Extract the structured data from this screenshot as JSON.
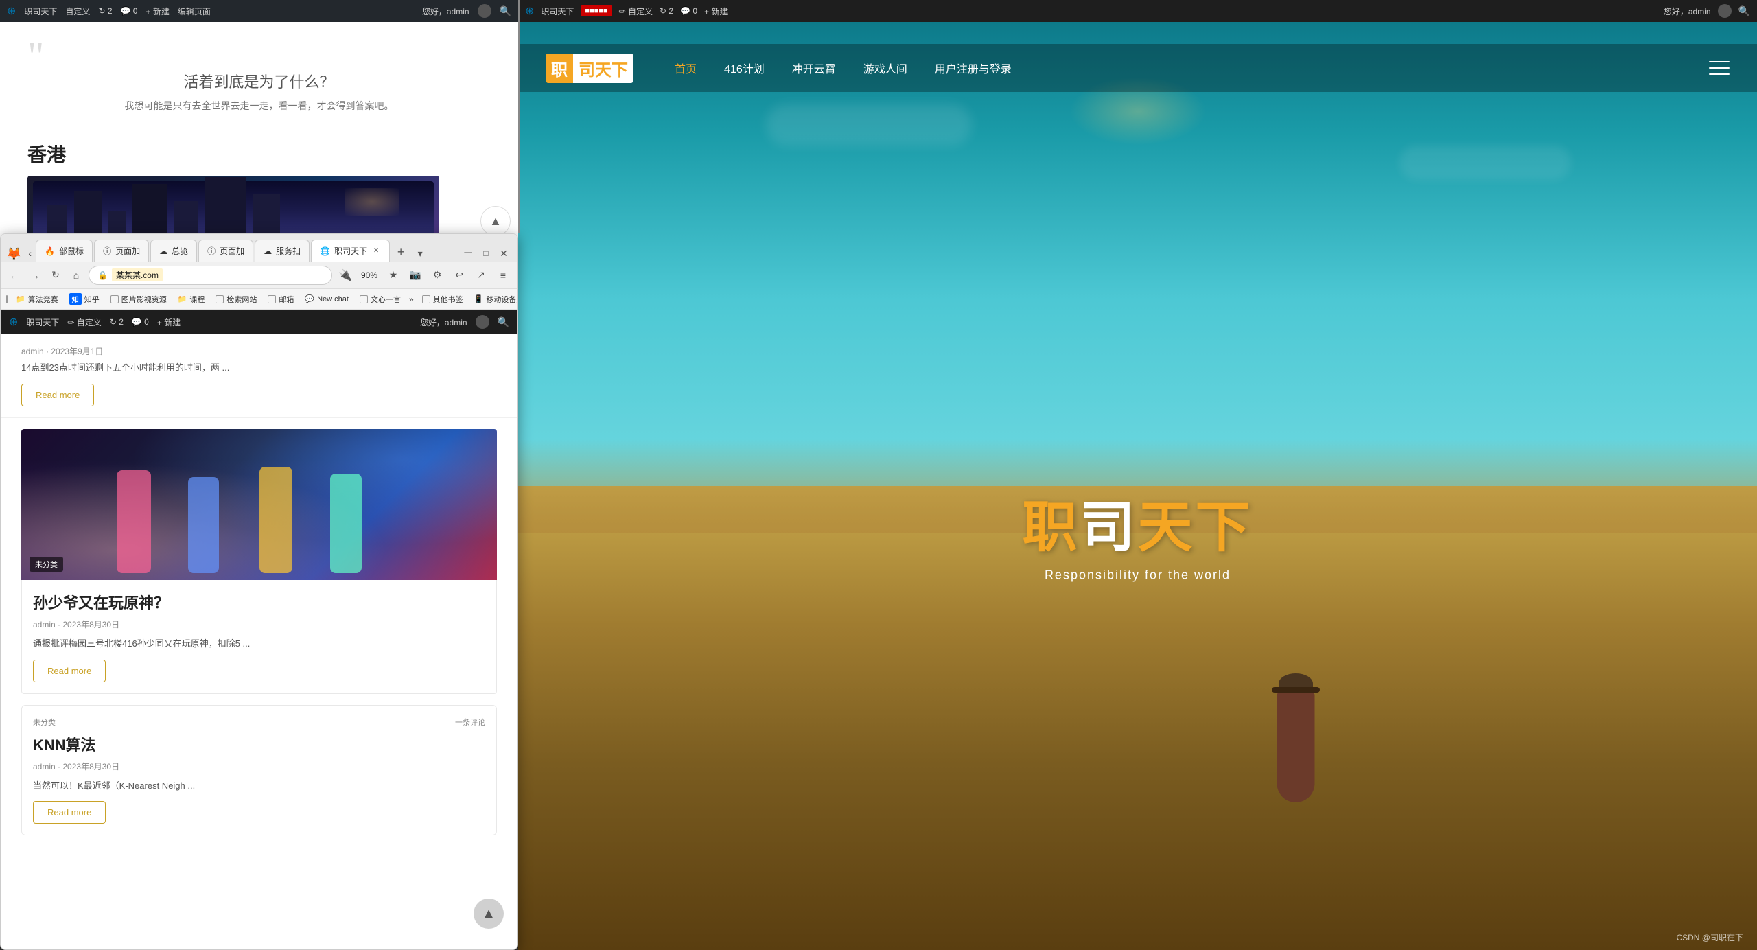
{
  "left_page": {
    "wp_bar": {
      "logo": "W",
      "site_name": "职司天下",
      "customize": "自定义",
      "updates_icon": "2",
      "comments_icon": "0",
      "new_item": "+ 新建",
      "edit_page": "编辑页面",
      "greeting": "您好，admin"
    },
    "quote": {
      "mark": "““",
      "text": "活着到底是为了什么？",
      "sub": "我想可能是只有去全世界去走一走，看一看，才会得到答案吧。"
    },
    "hk_section": {
      "title": "香港"
    },
    "blog_posts": [
      {
        "category": "未分类",
        "comment_count": "一条评论",
        "title": "KNN算法",
        "author": "admin",
        "date": "2023年8月30日",
        "excerpt": "当然可以！K最近邻（K-Nearest Neigh ...",
        "read_more": "Read more"
      }
    ],
    "featured_post": {
      "category_badge": "未分类",
      "title": "孙少爷又在玩原神？",
      "author": "admin",
      "date": "2023年8月30日",
      "excerpt": "通报批评梅园三号北楼416孙少同又在玩原神，扣除5 ...",
      "read_more": "Read more"
    },
    "first_read_more": "Read more",
    "third_read_more": "Read more",
    "first_post_excerpt": "14点到23点时间还剩下五个小时能利用的时间，两 ..."
  },
  "browser": {
    "tabs": [
      {
        "label": "部鼠标",
        "icon": "🦊"
      },
      {
        "label": "页面加",
        "icon": "ⓘ"
      },
      {
        "label": "总览",
        "icon": "☁"
      },
      {
        "label": "页面加",
        "icon": "ⓘ"
      },
      {
        "label": "服务扫",
        "icon": "☁"
      },
      {
        "label": "职司天下",
        "icon": "🌐",
        "active": true
      },
      {
        "label": "",
        "icon": ""
      }
    ],
    "address": "某某某.com",
    "zoom": "90%",
    "bookmarks": [
      {
        "label": "算法竞赛"
      },
      {
        "label": "知乎"
      },
      {
        "label": "图片影视资源"
      },
      {
        "label": "课程"
      },
      {
        "label": "检索网站"
      },
      {
        "label": "邮箱"
      },
      {
        "label": "New chat"
      },
      {
        "label": "文心一言"
      },
      {
        "label": "其他书签"
      },
      {
        "label": "移动设备上的书签"
      }
    ]
  },
  "right_site": {
    "wp_bar": {
      "logo": "W",
      "site_name": "职司天下",
      "customize": "自定义",
      "updates": "2",
      "comments": "0",
      "new_item": "+ 新建",
      "greeting": "您好，admin"
    },
    "header": {
      "logo_left": "职",
      "logo_right": "司天下",
      "nav_items": [
        "首页",
        "416计划",
        "冲开云霄",
        "游戏人间",
        "用户注册与登录"
      ],
      "active_nav": "首页"
    },
    "hero": {
      "main_title_left": "职",
      "main_title_mid": "司",
      "main_title_right": "天下",
      "subtitle": "Responsibility for the world"
    },
    "csdn_watermark": "CSDN @司职在下"
  }
}
